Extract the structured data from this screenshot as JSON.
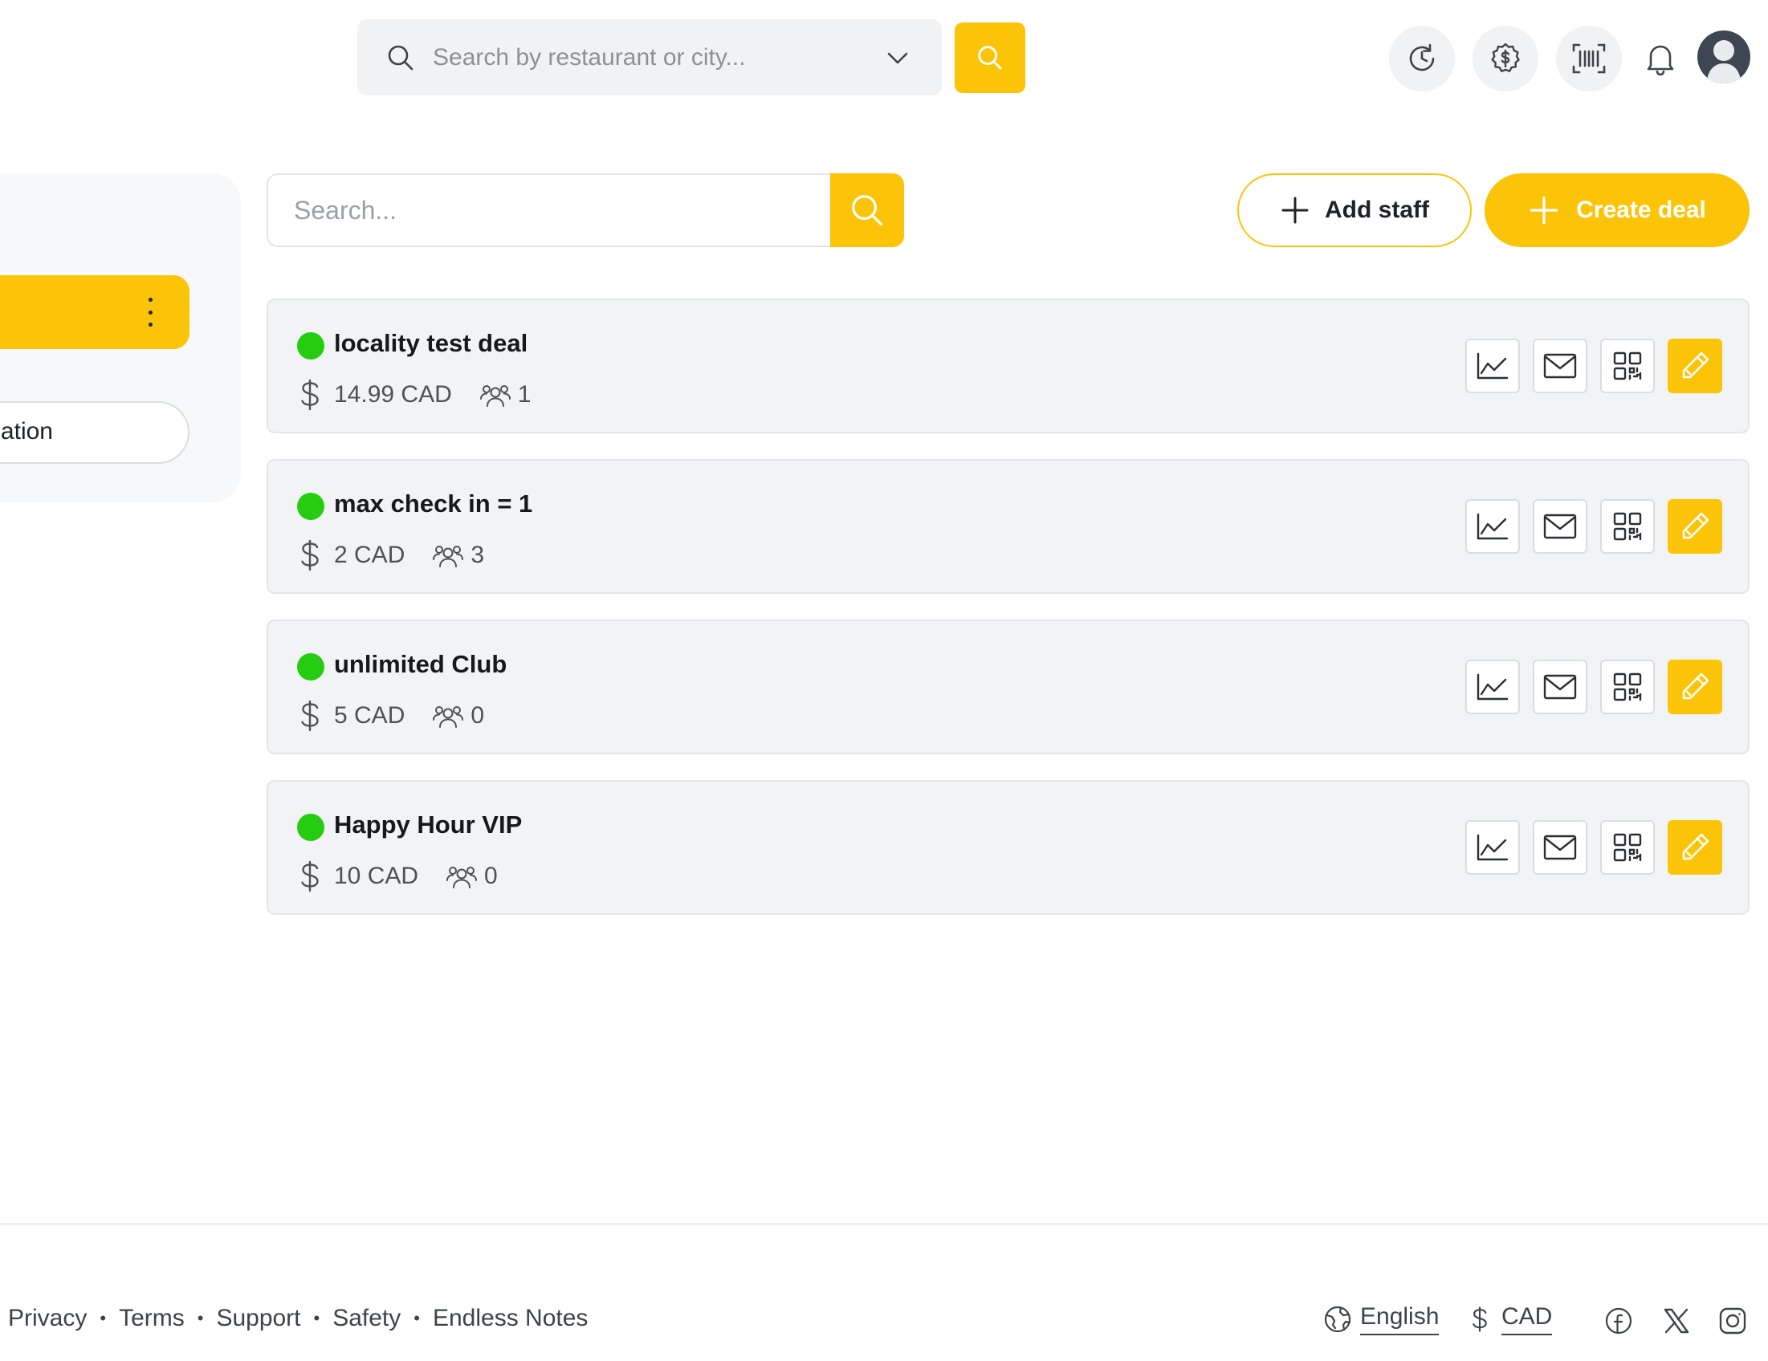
{
  "header": {
    "search_placeholder": "Search by restaurant or city...",
    "icons": [
      "history-icon",
      "dollar-badge-icon",
      "barcode-icon",
      "bell-icon",
      "avatar"
    ]
  },
  "sidebar": {
    "location_label": "Location"
  },
  "toolbar": {
    "search_placeholder": "Search...",
    "add_staff_label": "Add staff",
    "create_deal_label": "Create deal"
  },
  "deals": [
    {
      "name": "locality test deal",
      "price": "14.99 CAD",
      "members": "1",
      "status_color": "#26cc0f"
    },
    {
      "name": "max check in = 1",
      "price": "2 CAD",
      "members": "3",
      "status_color": "#26cc0f"
    },
    {
      "name": "unlimited Club",
      "price": "5 CAD",
      "members": "0",
      "status_color": "#26cc0f"
    },
    {
      "name": "Happy Hour VIP",
      "price": "10 CAD",
      "members": "0",
      "status_color": "#26cc0f"
    }
  ],
  "footer": {
    "links": [
      "Privacy",
      "Terms",
      "Support",
      "Safety",
      "Endless Notes"
    ],
    "language": "English",
    "currency": "CAD",
    "social": [
      "facebook-icon",
      "x-icon",
      "instagram-icon"
    ]
  },
  "colors": {
    "accent": "#fcc409",
    "status_active": "#26cc0f",
    "card_bg": "#f2f3f5"
  }
}
